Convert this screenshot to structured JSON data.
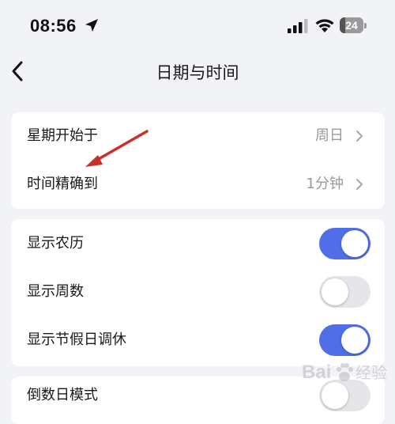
{
  "status_bar": {
    "time": "08:56",
    "battery_level": "24",
    "battery_fraction": 0.24,
    "icons": [
      "location-arrow-icon",
      "cellular-signal-icon",
      "wifi-icon",
      "battery-icon"
    ]
  },
  "nav": {
    "title": "日期与时间",
    "back_icon": "chevron-left-icon"
  },
  "sections": [
    {
      "rows": [
        {
          "label": "星期开始于",
          "value": "周日"
        },
        {
          "label": "时间精确到",
          "value": "1分钟"
        }
      ]
    },
    {
      "rows": [
        {
          "label": "显示农历",
          "toggle": true
        },
        {
          "label": "显示周数",
          "toggle": false
        },
        {
          "label": "显示节假日调休",
          "toggle": true
        }
      ]
    },
    {
      "rows": [
        {
          "label": "倒数日模式",
          "toggle": false
        }
      ]
    }
  ],
  "annotation": {
    "type": "red-arrow",
    "color": "#c8302a"
  },
  "watermark": {
    "text": "Bai 经验",
    "brand": "baidu-paw-icon"
  },
  "colors": {
    "background": "#f2f3f7",
    "card": "#ffffff",
    "toggle_on": "#4f6ee8",
    "toggle_off": "#e6e6ea",
    "secondary_text": "#9a9a9a"
  }
}
